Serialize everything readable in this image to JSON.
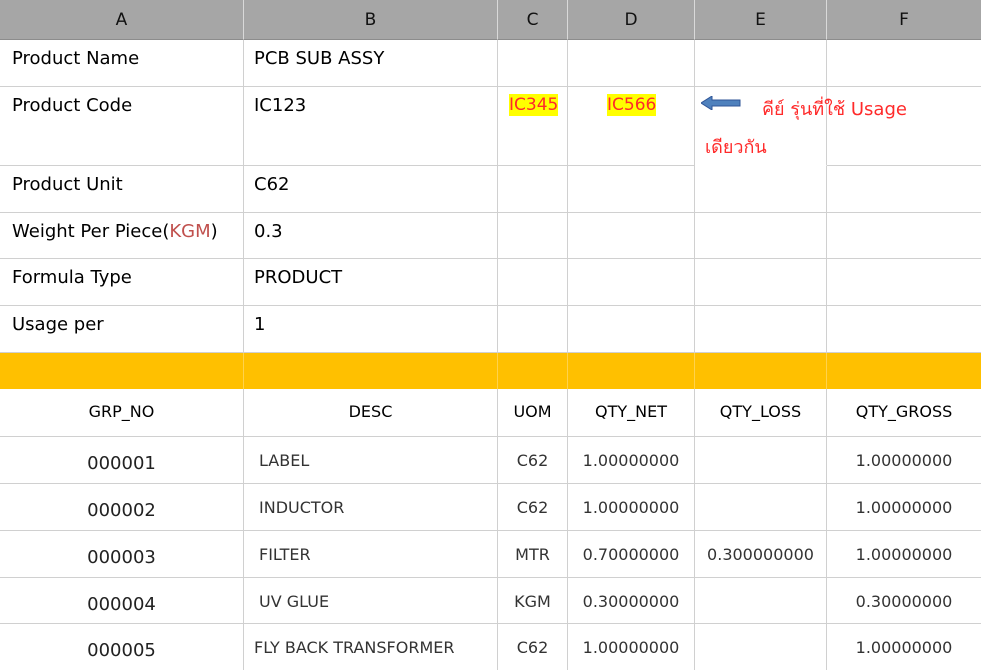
{
  "columns": [
    "A",
    "B",
    "C",
    "D",
    "E",
    "F"
  ],
  "info_rows": [
    {
      "label": "Product Name",
      "value": "PCB SUB ASSY"
    },
    {
      "label": "Product Code",
      "value": "IC123"
    },
    {
      "label": "Product Unit",
      "value": "C62"
    },
    {
      "label": "Weight Per Piece(",
      "label_unit": "KGM",
      "label_close": ")",
      "value": "0.3"
    },
    {
      "label": "Formula Type",
      "value": "PRODUCT"
    },
    {
      "label": "Usage per",
      "value": "1"
    }
  ],
  "alt_codes": [
    "IC345",
    "IC566"
  ],
  "note": {
    "line1": "คีย์ รุ่นที่ใช้ Usage",
    "line2": "เดียวกัน"
  },
  "arrow_icon": "left-arrow-icon",
  "highlight_color": "#ffc000",
  "table": {
    "headers": [
      "GRP_NO",
      "DESC",
      "UOM",
      "QTY_NET",
      "QTY_LOSS",
      "QTY_GROSS"
    ],
    "rows": [
      [
        "000001",
        "LABEL",
        "C62",
        "1.00000000",
        "",
        "1.00000000"
      ],
      [
        "000002",
        "INDUCTOR",
        "C62",
        "1.00000000",
        "",
        "1.00000000"
      ],
      [
        "000003",
        "FILTER",
        "MTR",
        "0.70000000",
        "0.300000000",
        "1.00000000"
      ],
      [
        "000004",
        "UV GLUE",
        "KGM",
        "0.30000000",
        "",
        "0.30000000"
      ],
      [
        "000005",
        "FLY BACK TRANSFORMER",
        "C62",
        "1.00000000",
        "",
        "1.00000000"
      ]
    ]
  }
}
